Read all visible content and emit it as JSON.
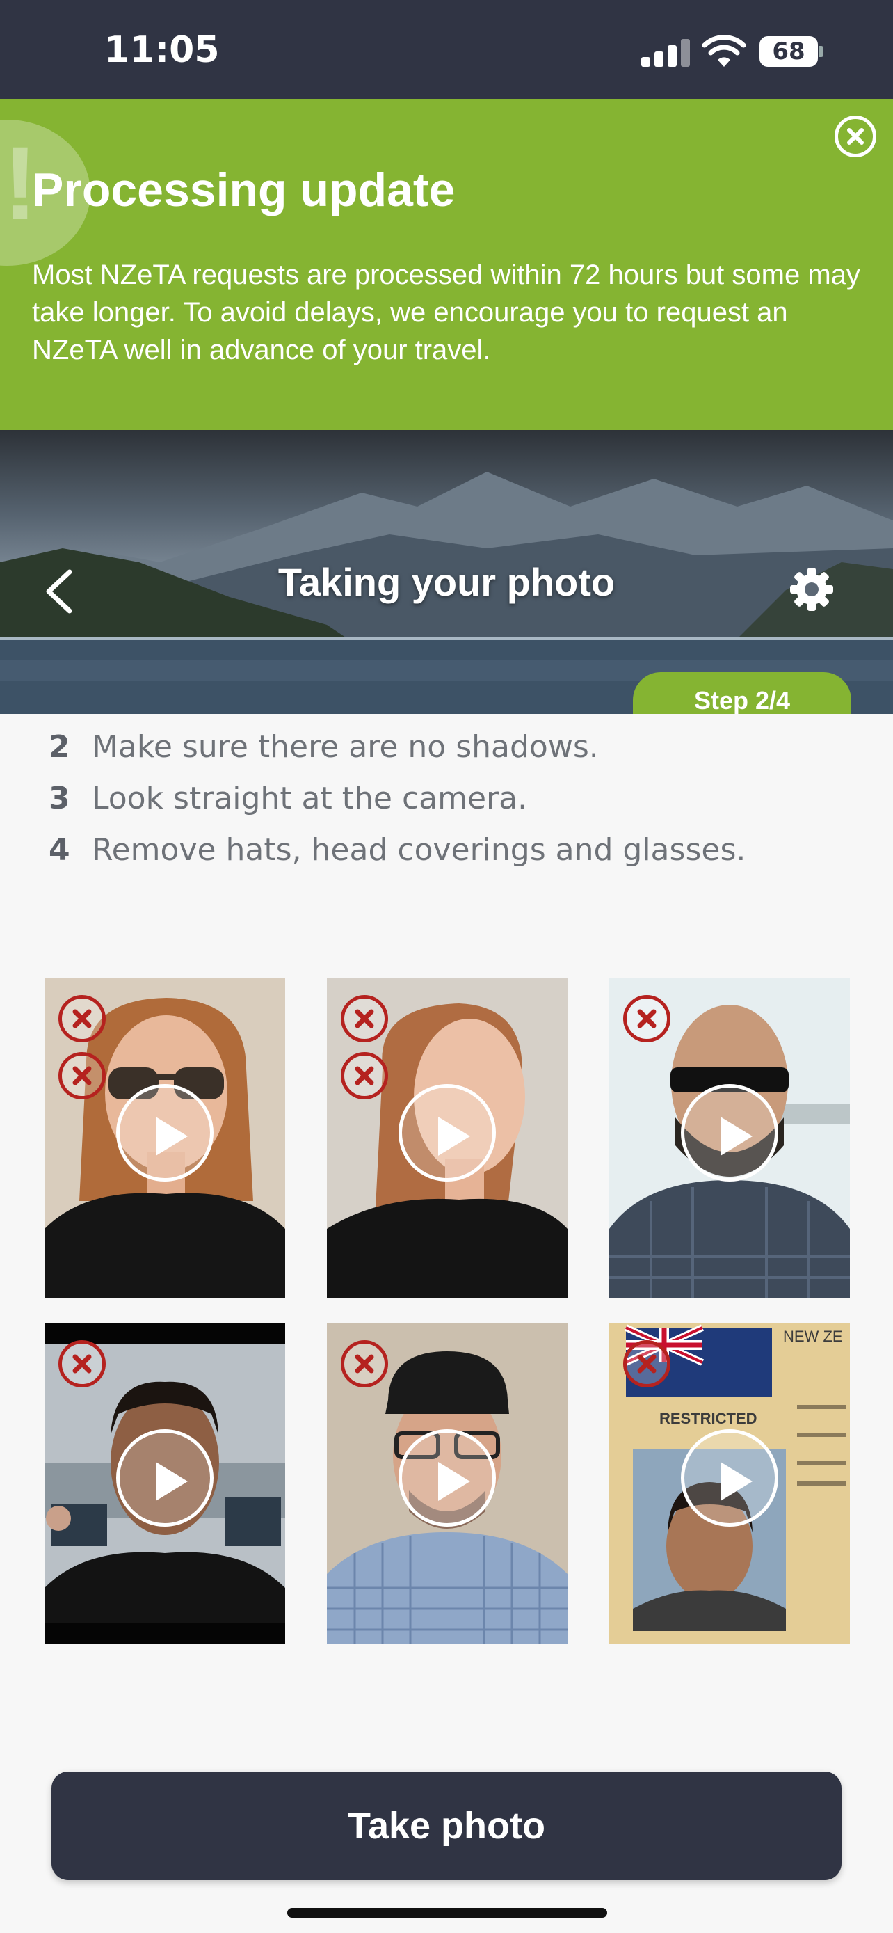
{
  "status_bar": {
    "time": "11:05",
    "battery": "68"
  },
  "banner": {
    "title": "Processing update",
    "body": "Most NZeTA requests are processed within 72 hours but some may take longer. To avoid delays, we encourage you to request an NZeTA well in advance of your travel.",
    "color": "#85b432"
  },
  "header": {
    "title": "Taking your photo",
    "step": "Step 2/4"
  },
  "instructions": [
    {
      "num": "2",
      "text": "Make sure there are no shadows."
    },
    {
      "num": "3",
      "text": "Look straight at the camera."
    },
    {
      "num": "4",
      "text": "Remove hats, head coverings and glasses."
    }
  ],
  "examples": [
    {
      "icon": "sunglasses-example",
      "marks": 2
    },
    {
      "icon": "looking-away-example",
      "marks": 2
    },
    {
      "icon": "dark-glasses-example",
      "marks": 1
    },
    {
      "icon": "background-people-example",
      "marks": 1
    },
    {
      "icon": "hat-example",
      "marks": 1
    },
    {
      "icon": "photo-of-id-example",
      "marks": 1
    }
  ],
  "id_card_text": {
    "country": "NEW ZE",
    "restricted": "RESTRICTED"
  },
  "buttons": {
    "take_photo": "Take photo"
  },
  "colors": {
    "dark": "#303444",
    "accent": "#85b432",
    "warning": "#b5221f"
  }
}
